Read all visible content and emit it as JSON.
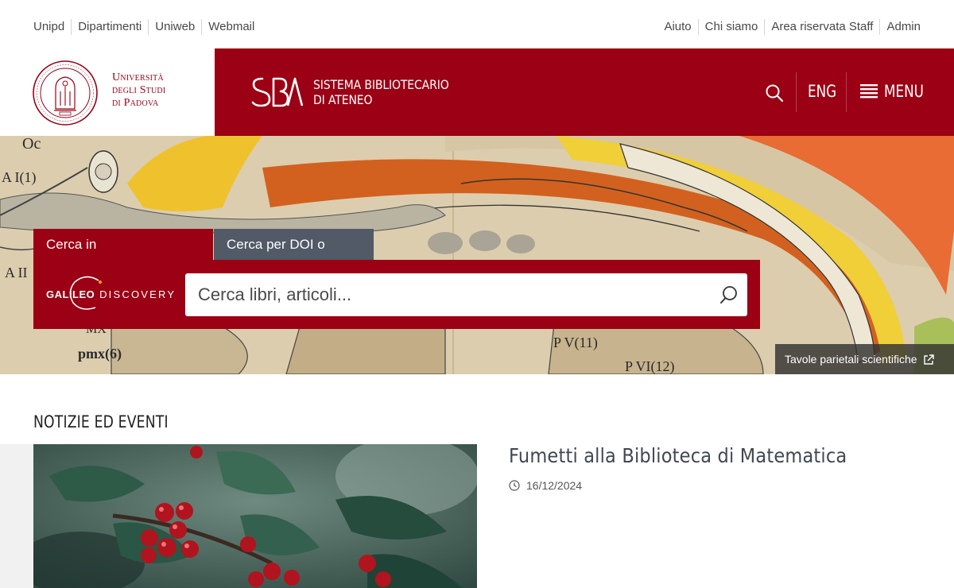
{
  "utility": {
    "left_links": [
      "Unipd",
      "Dipartimenti",
      "Uniweb",
      "Webmail"
    ],
    "right_links": [
      "Aiuto",
      "Chi siamo",
      "Area riservata Staff",
      "Admin"
    ]
  },
  "header": {
    "university_line1": "Università",
    "university_line2": "degli Studi",
    "university_line3": "di Padova",
    "seal_text": "Universitas Studii Paduani",
    "sba_mark": "SBA",
    "sba_line1": "SISTEMA BIBLIOTECARIO",
    "sba_line2": "DI ATENEO",
    "lang_label": "ENG",
    "menu_label": "MENU",
    "icons": [
      "search-icon",
      "hamburger-icon"
    ]
  },
  "search": {
    "tabs": [
      "Cerca in GalileoDiscovery",
      "Cerca per DOI o PMID"
    ],
    "active_tab": 0,
    "logo_text": "GALILEO DISCOVERY",
    "logo_bold": "GALILEO",
    "logo_rest": "DISCOVERY",
    "placeholder": "Cerca libri, articoli...",
    "value": ""
  },
  "hero": {
    "credit_label": "Tavole parietali scientifiche",
    "labels": [
      "Oc",
      "A I(1)",
      "A II",
      "MX",
      "pmx(6)",
      "P V(11)",
      "P VI(12)"
    ]
  },
  "news": {
    "heading": "NOTIZIE ED EVENTI",
    "items": [
      {
        "title": "Fumetti alla Biblioteca di Matematica",
        "date": "16/12/2024"
      }
    ]
  },
  "colors": {
    "brand_red": "#9b0014",
    "tab_gray": "#515a66"
  }
}
